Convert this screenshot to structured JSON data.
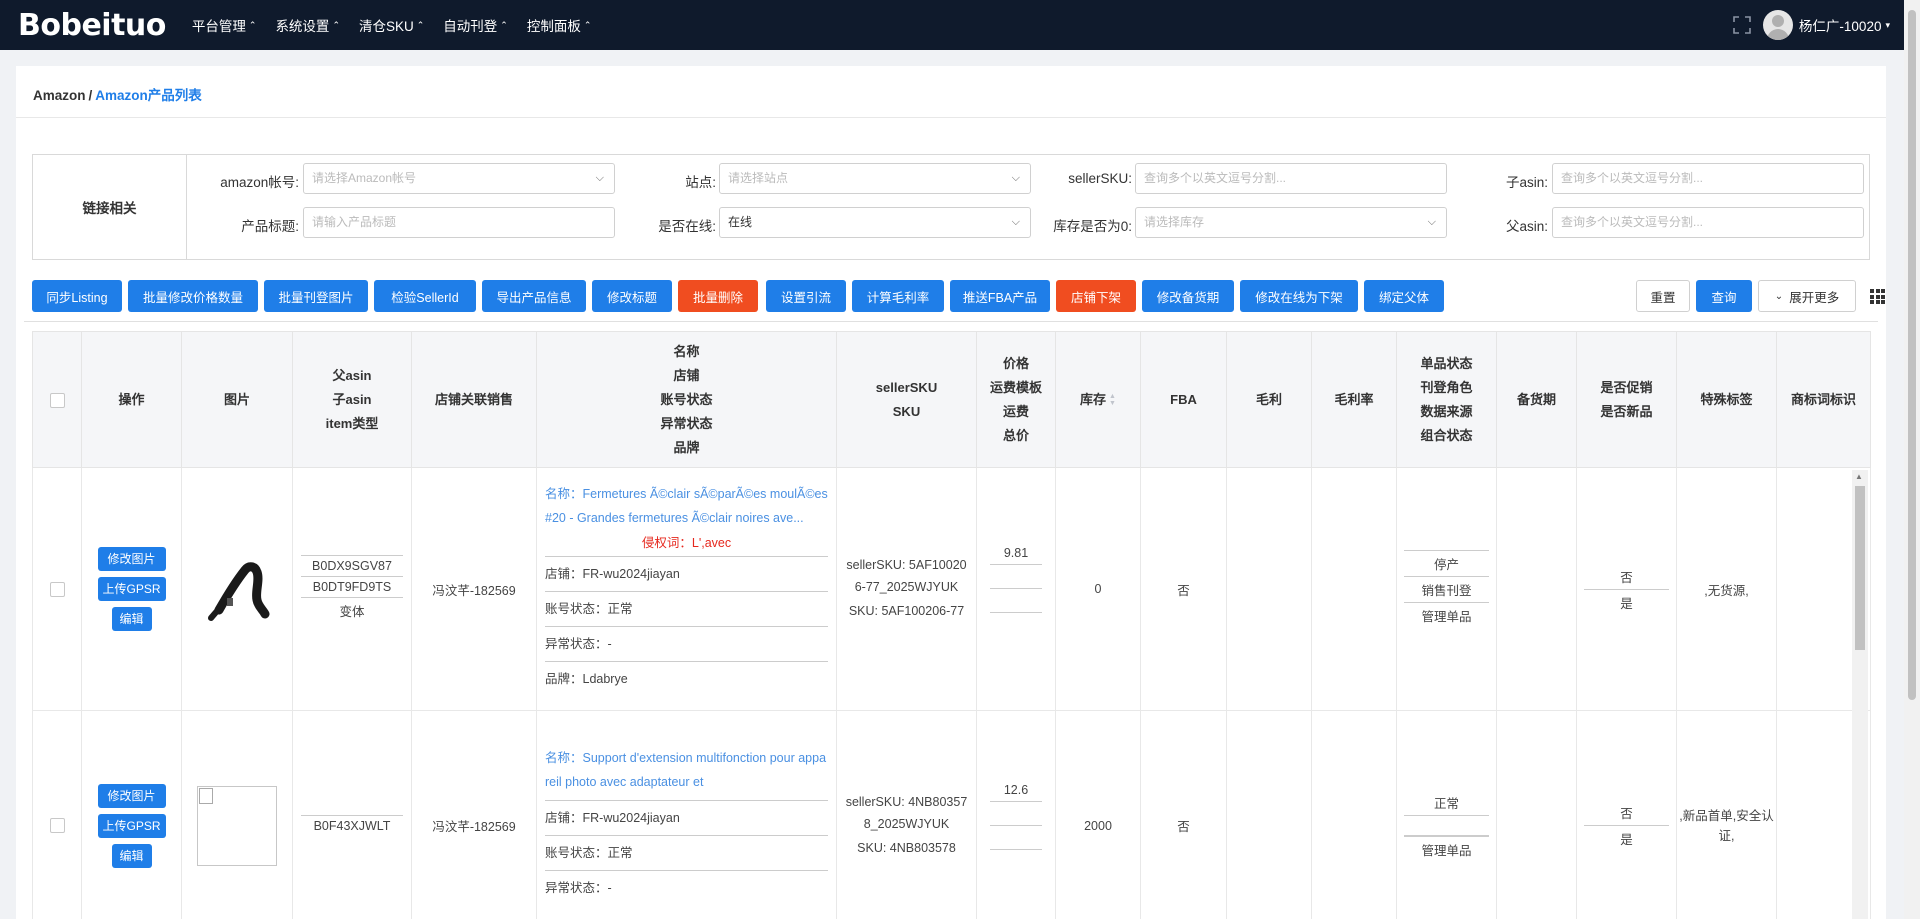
{
  "app": {
    "logo": "Bobeituo",
    "nav": [
      "平台管理",
      "系统设置",
      "清仓SKU",
      "自动刊登",
      "控制面板"
    ],
    "user": "杨仁广-10020"
  },
  "breadcrumb": {
    "root": "Amazon",
    "sep": "/",
    "current": "Amazon产品列表"
  },
  "filters": {
    "section_title": "链接相关",
    "amazon_account": {
      "label": "amazon帐号:",
      "placeholder": "请选择Amazon帐号"
    },
    "site": {
      "label": "站点:",
      "placeholder": "请选择站点"
    },
    "seller_sku": {
      "label": "sellerSKU:",
      "placeholder": "查询多个以英文逗号分割..."
    },
    "child_asin": {
      "label": "子asin:",
      "placeholder": "查询多个以英文逗号分割..."
    },
    "product_title": {
      "label": "产品标题:",
      "placeholder": "请输入产品标题"
    },
    "online": {
      "label": "是否在线:",
      "value": "在线"
    },
    "stock_zero": {
      "label": "库存是否为0:",
      "placeholder": "请选择库存"
    },
    "parent_asin": {
      "label": "父asin:",
      "placeholder": "查询多个以英文逗号分割..."
    }
  },
  "actions": [
    "同步Listing",
    "批量修改价格数量",
    "批量刊登图片",
    "检验SellerId",
    "导出产品信息",
    "修改标题",
    "批量删除",
    "设置引流",
    "计算毛利率",
    "推送FBA产品",
    "店铺下架",
    "修改备货期",
    "修改在线为下架",
    "绑定父体"
  ],
  "right_actions": {
    "reset": "重置",
    "query": "查询",
    "expand": "展开更多"
  },
  "table": {
    "headers": {
      "op": "操作",
      "img": "图片",
      "asin": [
        "父asin",
        "子asin",
        "item类型"
      ],
      "store_sales": "店铺关联销售",
      "name": [
        "名称",
        "店铺",
        "账号状态",
        "异常状态",
        "品牌"
      ],
      "sku": [
        "sellerSKU",
        "SKU"
      ],
      "price": [
        "价格",
        "运费模板",
        "运费",
        "总价"
      ],
      "stock": "库存",
      "fba": "FBA",
      "profit": "毛利",
      "profit_rate": "毛利率",
      "status": [
        "单品状态",
        "刊登角色",
        "数据来源",
        "组合状态"
      ],
      "lead_time": "备货期",
      "promo": [
        "是否促销",
        "是否新品"
      ],
      "special": "特殊标签",
      "trademark": "商标词标识"
    },
    "op_buttons": {
      "edit_img": "修改图片",
      "upload_gpsr": "上传GPSR",
      "edit": "编辑"
    },
    "rows": [
      {
        "parent_asin": "B0DX9SGV87",
        "child_asin": "B0DT9FD9TS",
        "item_type": "变体",
        "store_sales": "冯汶芊-182569",
        "name": "名称：Fermetures Ã©clair sÃ©parÃ©es moulÃ©es #20 - Grandes fermetures Ã©clair noires ave...",
        "infringe": "侵权词：L',avec",
        "store": "店铺：FR-wu2024jiayan",
        "account_status": "账号状态：正常",
        "abnormal": "异常状态：-",
        "brand": "品牌：Ldabrye",
        "seller_sku": "sellerSKU: 5AF100206-77_2025WJYUK",
        "sku": "SKU: 5AF100206-77",
        "price": "9.81",
        "stock": "0",
        "fba": "否",
        "status": [
          "停产",
          "销售刊登",
          "管理单品"
        ],
        "promo": "否",
        "new": "是",
        "special": ",无货源,"
      },
      {
        "parent_asin": "",
        "child_asin": "B0F43XJWLT",
        "item_type": "",
        "store_sales": "冯汶芊-182569",
        "name": "名称：Support d'extension multifonction pour appareil photo avec adaptateur et",
        "store": "店铺：FR-wu2024jiayan",
        "account_status": "账号状态：正常",
        "abnormal": "异常状态：-",
        "seller_sku": "sellerSKU: 4NB803578_2025WJYUK",
        "sku": "SKU: 4NB803578",
        "price": "12.6",
        "stock": "2000",
        "fba": "否",
        "status": [
          "正常",
          "",
          "管理单品"
        ],
        "promo": "否",
        "new": "是",
        "special": ",新品首单,安全认证,"
      }
    ]
  }
}
